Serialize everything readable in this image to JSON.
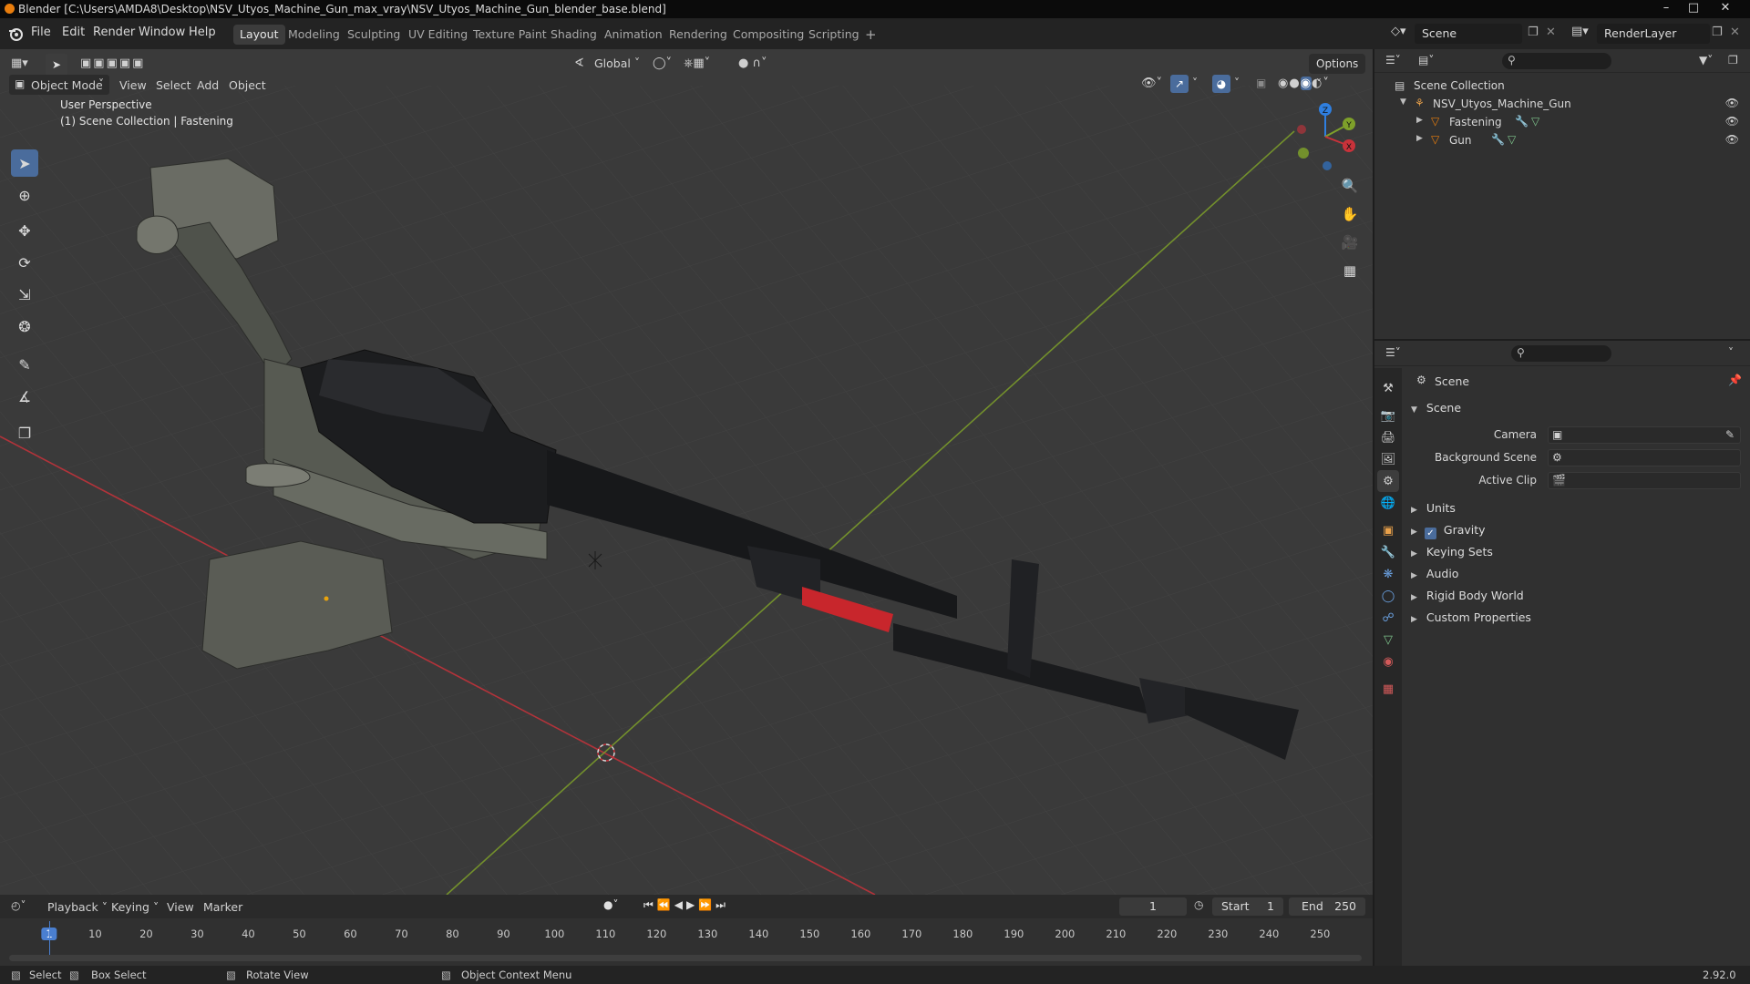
{
  "window": {
    "title": "Blender [C:\\Users\\AMDA8\\Desktop\\NSV_Utyos_Machine_Gun_max_vray\\NSV_Utyos_Machine_Gun_blender_base.blend]",
    "controls": [
      "–",
      "□",
      "✕"
    ]
  },
  "menu": [
    "File",
    "Edit",
    "Render",
    "Window",
    "Help"
  ],
  "workspaces": [
    {
      "label": "Layout",
      "active": true
    },
    {
      "label": "Modeling"
    },
    {
      "label": "Sculpting"
    },
    {
      "label": "UV Editing"
    },
    {
      "label": "Texture Paint"
    },
    {
      "label": "Shading"
    },
    {
      "label": "Animation"
    },
    {
      "label": "Rendering"
    },
    {
      "label": "Compositing"
    },
    {
      "label": "Scripting"
    }
  ],
  "add_workspace": "+",
  "scene_selector": "Scene",
  "renderlayer_selector": "RenderLayer",
  "viewport": {
    "mode": "Object Mode",
    "menus": [
      "View",
      "Select",
      "Add",
      "Object"
    ],
    "transform_orientation": "Global",
    "options_label": "Options",
    "perspective_label": "User Perspective",
    "collection_label": "(1) Scene Collection | Fastening",
    "gizmo_axes": {
      "x": "X",
      "y": "Y",
      "z": "Z"
    }
  },
  "outliner": {
    "root": "Scene Collection",
    "collection": "NSV_Utyos_Machine_Gun",
    "objects": [
      {
        "name": "Fastening"
      },
      {
        "name": "Gun"
      }
    ]
  },
  "properties": {
    "context_title": "Scene",
    "panel_title": "Scene",
    "fields": [
      {
        "label": "Camera"
      },
      {
        "label": "Background Scene"
      },
      {
        "label": "Active Clip"
      }
    ],
    "subpanels": [
      {
        "label": "Units",
        "checkbox": false
      },
      {
        "label": "Gravity",
        "checkbox": true
      },
      {
        "label": "Keying Sets",
        "checkbox": false
      },
      {
        "label": "Audio",
        "checkbox": false
      },
      {
        "label": "Rigid Body World",
        "checkbox": false
      },
      {
        "label": "Custom Properties",
        "checkbox": false
      }
    ]
  },
  "timeline": {
    "menus": [
      "Playback",
      "Keying",
      "View",
      "Marker"
    ],
    "current_frame": "1",
    "start_label": "Start",
    "start_value": "1",
    "end_label": "End",
    "end_value": "250",
    "ticks": [
      "1",
      "10",
      "20",
      "30",
      "40",
      "50",
      "60",
      "70",
      "80",
      "90",
      "100",
      "110",
      "120",
      "130",
      "140",
      "150",
      "160",
      "170",
      "180",
      "190",
      "200",
      "210",
      "220",
      "230",
      "240",
      "250"
    ]
  },
  "status": {
    "select": "Select",
    "box_select": "Box Select",
    "rotate_view": "Rotate View",
    "context_menu": "Object Context Menu",
    "version": "2.92.0"
  },
  "colors": {
    "accent": "#4a6c9c",
    "x_axis": "#c8323a",
    "y_axis": "#7ea02a",
    "z_axis": "#2f7fe0",
    "object_orange": "#e87d0d"
  }
}
